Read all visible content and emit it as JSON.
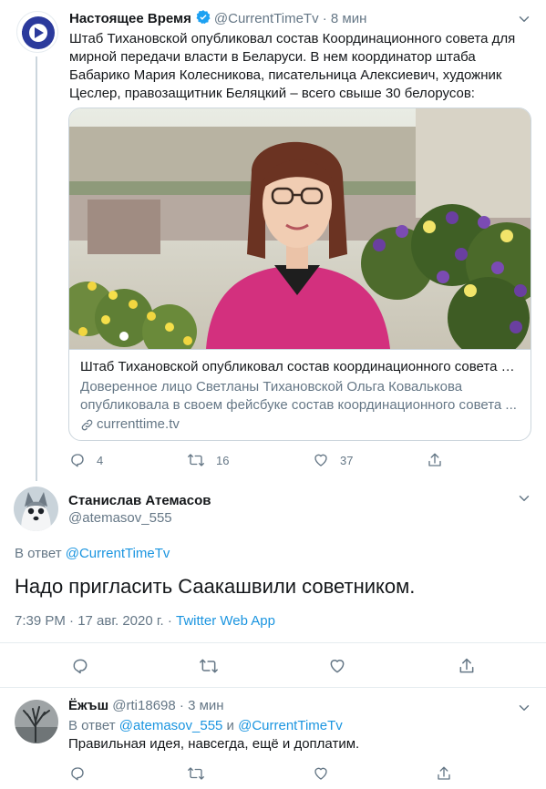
{
  "colors": {
    "accent": "#1b95e0",
    "muted": "#657786",
    "text": "#14171a",
    "border": "#ccd6dd"
  },
  "tweet1": {
    "name": "Настоящее Время",
    "verified_icon": "verified-badge-icon",
    "handle": "@CurrentTimeTv",
    "separator": "·",
    "time": "8 мин",
    "text": "Штаб Тихановской опубликовал состав Координационного совета для мирной передачи власти в Беларуси. В нем координатор штаба Бабарико Мария Колесникова, писательница Алексиевич, художник Цеслер, правозащитник Беляцкий – всего свыше 30 белорусов:",
    "card": {
      "title": "Штаб Тихановской опубликовал состав координационного совета п...",
      "description": "Доверенное лицо Светланы Тихановской Ольга Ковалькова опубликовала в своем фейсбуке состав координационного совета ...",
      "domain": "currenttime.tv"
    },
    "replies": "4",
    "retweets": "16",
    "likes": "37"
  },
  "tweet2": {
    "name": "Станислав Атемасов",
    "handle": "@atemasov_555",
    "replying_prefix": "В ответ ",
    "replying_to": "@CurrentTimeTv",
    "text": "Надо пригласить Саакашвили советником.",
    "timestamp": "7:39 PM · 17 авг. 2020 г. · ",
    "source": "Twitter Web App"
  },
  "tweet3": {
    "name": "Ёжъш",
    "handle": "@rti18698",
    "separator": "·",
    "time": "3 мин",
    "replying_prefix": "В ответ ",
    "replying_to_1": "@atemasov_555",
    "replying_and": " и ",
    "replying_to_2": "@CurrentTimeTv",
    "text": "Правильная идея, навсегда, ещё и доплатим."
  }
}
